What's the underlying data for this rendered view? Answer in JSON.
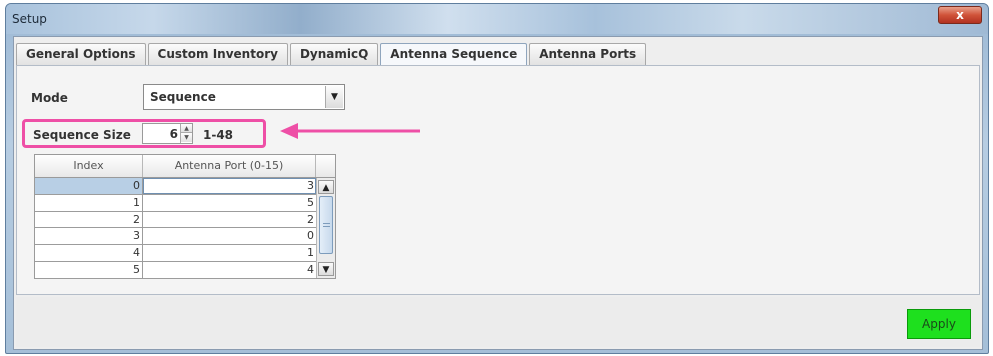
{
  "window": {
    "title": "Setup",
    "close_label": "x"
  },
  "tabs": [
    {
      "label": "General Options"
    },
    {
      "label": "Custom Inventory"
    },
    {
      "label": "DynamicQ"
    },
    {
      "label": "Antenna Sequence",
      "active": true
    },
    {
      "label": "Antenna Ports"
    }
  ],
  "mode": {
    "label": "Mode",
    "value": "Sequence"
  },
  "sequence": {
    "label": "Sequence Size",
    "value": "6",
    "range": "1-48"
  },
  "table": {
    "headers": [
      "Index",
      "Antenna Port (0-15)"
    ],
    "rows": [
      {
        "index": "0",
        "port": "3",
        "selected": true
      },
      {
        "index": "1",
        "port": "5"
      },
      {
        "index": "2",
        "port": "2"
      },
      {
        "index": "3",
        "port": "0"
      },
      {
        "index": "4",
        "port": "1"
      },
      {
        "index": "5",
        "port": "4"
      }
    ]
  },
  "apply_label": "Apply",
  "colors": {
    "highlight": "#ee4fa6",
    "apply": "#1ee01e"
  }
}
